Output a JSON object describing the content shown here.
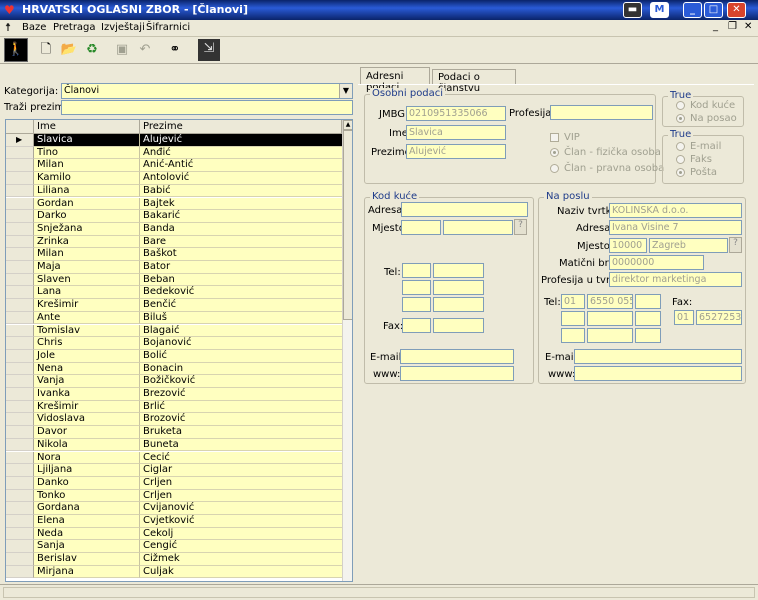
{
  "window": {
    "title": "HRVATSKI OGLASNI ZBOR - [Članovi]"
  },
  "menu": [
    "Baze",
    "Pretraga",
    "Izvještaji",
    "Šifrarnici"
  ],
  "toolbar": {
    "icons": [
      "person-icon",
      "new-doc-icon",
      "open-icon",
      "recycle-icon",
      "save-icon",
      "undo-icon",
      "binoculars-icon",
      "exit-door-icon"
    ]
  },
  "filter": {
    "kategorija_label": "Kategorija:",
    "kategorija_value": "Članovi",
    "search_label": "Traži prezime:",
    "search_value": ""
  },
  "grid": {
    "headers": [
      "Ime",
      "Prezime"
    ],
    "selected_index": 0,
    "rows": [
      [
        "Slavica",
        "Alujević"
      ],
      [
        "Tino",
        "Anđić"
      ],
      [
        "Milan",
        "Anić-Antić"
      ],
      [
        "Kamilo",
        "Antolović"
      ],
      [
        "Liliana",
        "Babić"
      ],
      [
        "Gordan",
        "Bajtek"
      ],
      [
        "Darko",
        "Bakarić"
      ],
      [
        "Snježana",
        "Banda"
      ],
      [
        "Zrinka",
        "Bare"
      ],
      [
        "Milan",
        "Baškot"
      ],
      [
        "Maja",
        "Bator"
      ],
      [
        "Slaven",
        "Beban"
      ],
      [
        "Lana",
        "Bedeković"
      ],
      [
        "Krešimir",
        "Benčić"
      ],
      [
        "Ante",
        "Biluš"
      ],
      [
        "Tomislav",
        "Blagaić"
      ],
      [
        "Chris",
        "Bojanović"
      ],
      [
        "Jole",
        "Bolić"
      ],
      [
        "Nena",
        "Bonacin"
      ],
      [
        "Vanja",
        "Božičković"
      ],
      [
        "Ivanka",
        "Brezović"
      ],
      [
        "Krešimir",
        "Brlić"
      ],
      [
        "Vidoslava",
        "Brozović"
      ],
      [
        "Davor",
        "Bruketa"
      ],
      [
        "Nikola",
        "Buneta"
      ],
      [
        "Nora",
        "Cecić"
      ],
      [
        "Ljiljana",
        "Ciglar"
      ],
      [
        "Danko",
        "Crljen"
      ],
      [
        "Tonko",
        "Crljen"
      ],
      [
        "Gordana",
        "Cvijanović"
      ],
      [
        "Elena",
        "Cvjetković"
      ],
      [
        "Neda",
        "Čekolj"
      ],
      [
        "Sanja",
        "Čengić"
      ],
      [
        "Berislav",
        "Čižmek"
      ],
      [
        "Mirjana",
        "Čuljak"
      ]
    ]
  },
  "tabs": [
    "Adresni podaci",
    "Podaci o članstvu"
  ],
  "osobni": {
    "title": "Osobni podaci",
    "jmbg_label": "JMBG:",
    "jmbg": "0210951335066",
    "ime_label": "Ime:",
    "ime": "Slavica",
    "prezime_label": "Prezime:",
    "prezime": "Alujević",
    "profesija_label": "Profesija:",
    "profesija": "",
    "vip": "VIP",
    "clan_fiz": "Član - fizička osoba",
    "clan_prav": "Član - pravna osoba"
  },
  "true1": {
    "title": "True",
    "opt1": "Kod kuće",
    "opt2": "Na posao"
  },
  "true2": {
    "title": "True",
    "opt1": "E-mail",
    "opt2": "Faks",
    "opt3": "Pošta"
  },
  "kod_kuce": {
    "title": "Kod kuće",
    "adresa_label": "Adresa:",
    "mjesto_label": "Mjesto:",
    "tel_label": "Tel:",
    "fax_label": "Fax:",
    "email_label": "E-mail:",
    "www_label": "www:",
    "q": "?"
  },
  "na_poslu": {
    "title": "Na poslu",
    "tvrtka_label": "Naziv tvrtke:",
    "tvrtka": "KOLINSKA d.o.o.",
    "adresa_label": "Adresa:",
    "adresa": "Ivana Visine 7",
    "mjesto_label": "Mjesto:",
    "post": "10000",
    "grad": "Zagreb",
    "q": "?",
    "mb_label": "Matični broj:",
    "mb": "0000000",
    "prof_label": "Profesija u tvrtci:",
    "prof": "direktor marketinga",
    "tel_label": "Tel:",
    "tel_pre": "01",
    "tel_num": "6550 055",
    "fax_label": "Fax:",
    "fax_pre": "01",
    "fax_num": "6527253",
    "email_label": "E-mail:",
    "www_label": "www:"
  }
}
